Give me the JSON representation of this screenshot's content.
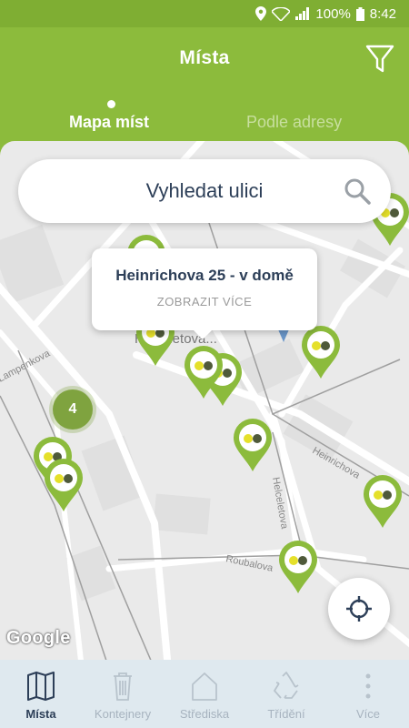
{
  "status_bar": {
    "battery": "100%",
    "time": "8:42"
  },
  "header": {
    "title": "Místa"
  },
  "tabs": [
    {
      "label": "Mapa míst",
      "active": true
    },
    {
      "label": "Podle adresy",
      "active": false
    }
  ],
  "search": {
    "placeholder": "Vyhledat ulici"
  },
  "popup": {
    "title": "Heinrichova 25 - v domě",
    "link": "ZOBRAZIT VÍCE"
  },
  "map": {
    "place_label": "Helceletova...",
    "cluster_count": "4",
    "attribution": "Google"
  },
  "nav": [
    {
      "label": "Místa",
      "icon": "map-icon",
      "active": true
    },
    {
      "label": "Kontejnery",
      "icon": "trash-icon",
      "active": false
    },
    {
      "label": "Střediska",
      "icon": "house-icon",
      "active": false
    },
    {
      "label": "Třídění",
      "icon": "recycle-icon",
      "active": false
    },
    {
      "label": "Více",
      "icon": "more-vertical-icon",
      "active": false
    }
  ],
  "colors": {
    "brand": "#8cbb3c",
    "marker": "#8cbb3c",
    "dot_yellow": "#e5e02a",
    "dot_dark": "#4f5a3a",
    "nav_bg": "#dfe9ef",
    "text_dark": "#2d3f58"
  }
}
